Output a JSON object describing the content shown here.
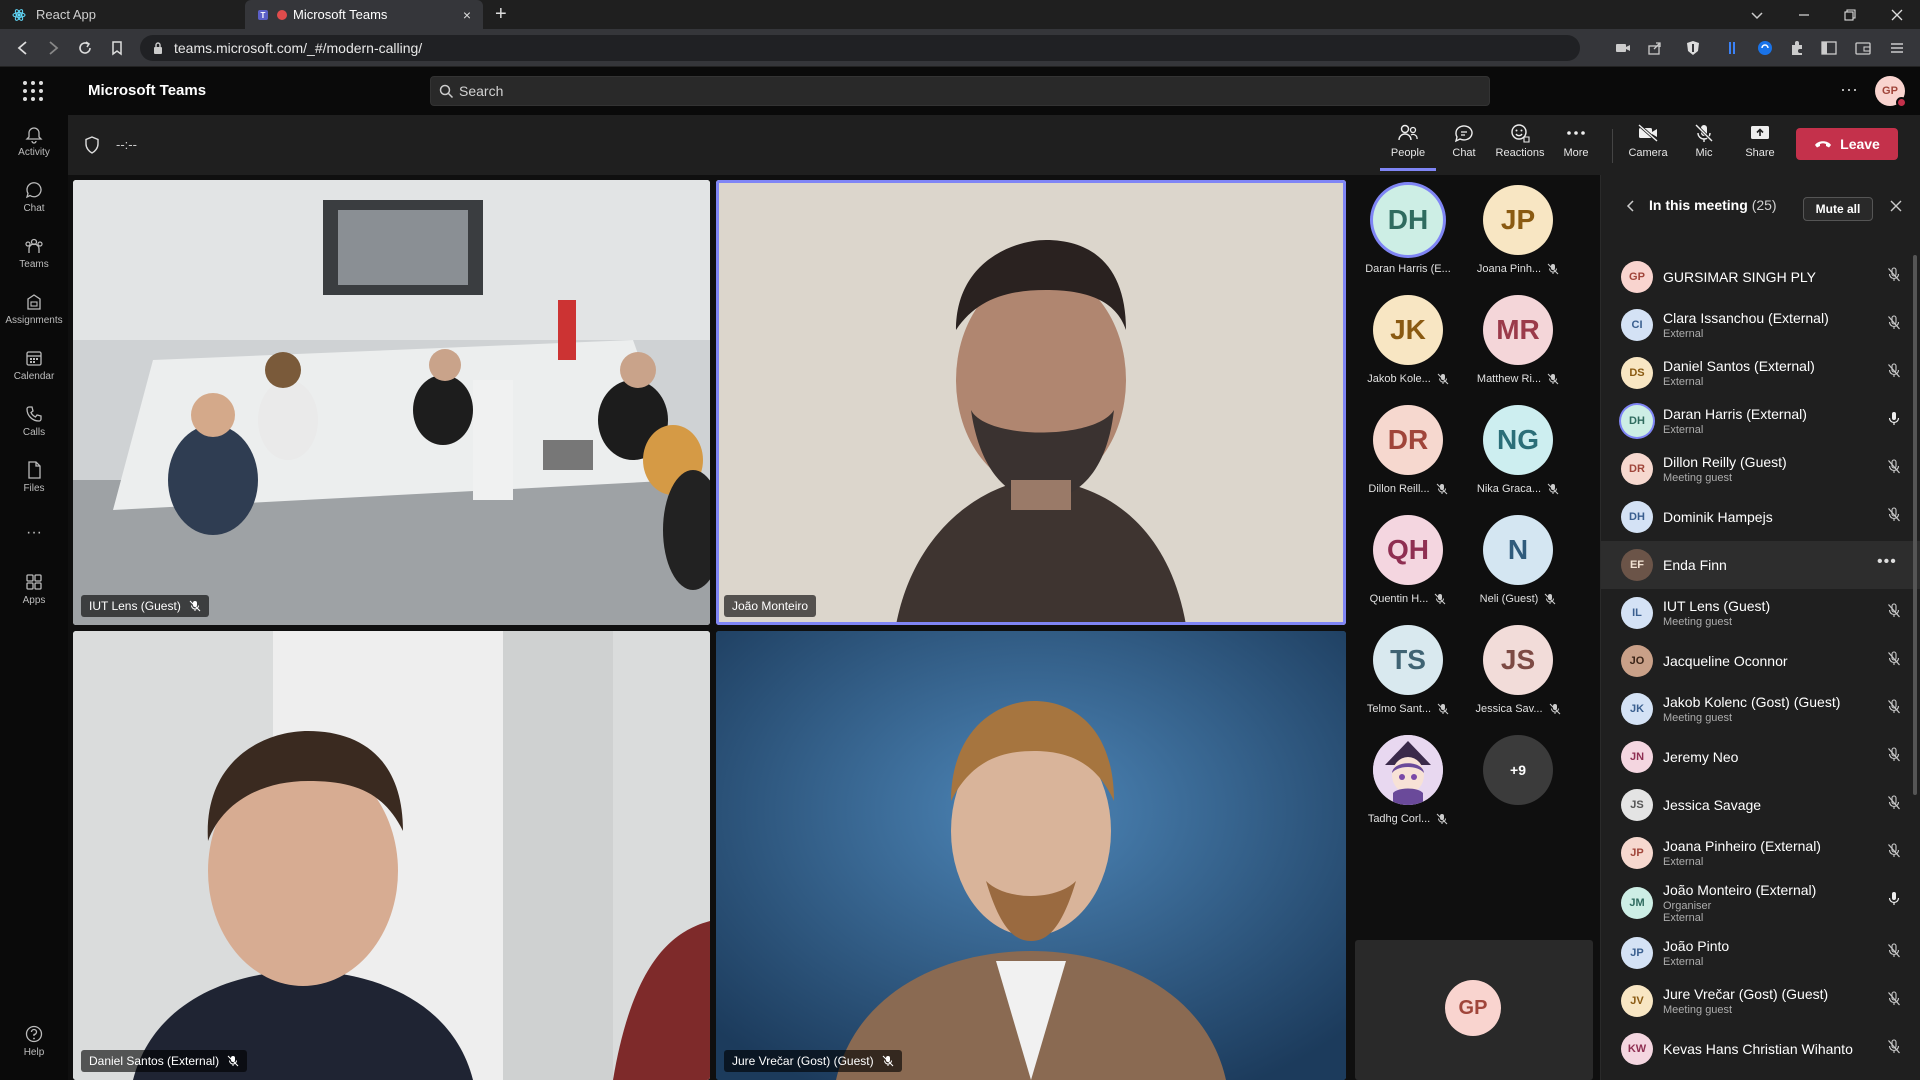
{
  "browser": {
    "tabs": [
      {
        "label": "React App"
      },
      {
        "label": "Microsoft Teams",
        "close": "×"
      }
    ],
    "new_tab": "+",
    "url": "teams.microsoft.com/_#/modern-calling/"
  },
  "teams": {
    "title": "Microsoft Teams",
    "search_placeholder": "Search",
    "more": "···",
    "user_initials": "GP"
  },
  "rail": [
    {
      "label": "Activity",
      "icon": "bell-icon"
    },
    {
      "label": "Chat",
      "icon": "chat-icon"
    },
    {
      "label": "Teams",
      "icon": "teams-icon"
    },
    {
      "label": "Assignments",
      "icon": "assignments-icon"
    },
    {
      "label": "Calendar",
      "icon": "calendar-icon"
    },
    {
      "label": "Calls",
      "icon": "phone-icon"
    },
    {
      "label": "Files",
      "icon": "file-icon"
    },
    {
      "label": "···",
      "icon": "more-icon"
    },
    {
      "label": "Apps",
      "icon": "apps-icon"
    },
    {
      "label": "Help",
      "icon": "help-icon"
    }
  ],
  "meeting": {
    "timer": "--:--",
    "toolbar": {
      "people": "People",
      "chat": "Chat",
      "reactions": "Reactions",
      "more": "More",
      "camera": "Camera",
      "mic": "Mic",
      "share": "Share",
      "leave": "Leave"
    },
    "tiles": [
      {
        "name": "IUT Lens (Guest)"
      },
      {
        "name": "João Monteiro"
      },
      {
        "name": "Daniel Santos (External)"
      },
      {
        "name": "Jure Vrečar (Gost) (Guest)"
      }
    ],
    "gallery": [
      {
        "initials": "DH",
        "label": "Daran Harris (E...",
        "bg": "#cdeee5",
        "fg": "#2f6b5f",
        "speaking": true
      },
      {
        "initials": "JP",
        "label": "Joana Pinh...",
        "bg": "#f8e6c3",
        "fg": "#8a5a12"
      },
      {
        "initials": "JK",
        "label": "Jakob Kole...",
        "bg": "#f8e6c3",
        "fg": "#8a5a12"
      },
      {
        "initials": "MR",
        "label": "Matthew Ri...",
        "bg": "#f4d6d9",
        "fg": "#9b3a4a"
      },
      {
        "initials": "DR",
        "label": "Dillon Reill...",
        "bg": "#f6d8cf",
        "fg": "#a0453a"
      },
      {
        "initials": "NG",
        "label": "Nika Graca...",
        "bg": "#cdeef0",
        "fg": "#2b6e78"
      },
      {
        "initials": "QH",
        "label": "Quentin H...",
        "bg": "#f4d6e0",
        "fg": "#8f2f52"
      },
      {
        "initials": "N",
        "label": "Neli (Guest)",
        "bg": "#d4e6f2",
        "fg": "#2f5b7c"
      },
      {
        "initials": "TS",
        "label": "Telmo Sant...",
        "bg": "#d9e9ef",
        "fg": "#3f6373"
      },
      {
        "initials": "JS",
        "label": "Jessica Sav...",
        "bg": "#f2dcd9",
        "fg": "#7d4a44"
      },
      {
        "initials": "",
        "label": "Tadhg Corl...",
        "bg": "#e8d8f0",
        "fg": "#5c3c78"
      },
      {
        "initials": "+9",
        "label": "",
        "bg": "#3b3b3b",
        "fg": "#ffffff"
      }
    ],
    "self_initials": "GP"
  },
  "panel": {
    "title": "In this meeting",
    "count": "(25)",
    "mute_all": "Mute all",
    "participants": [
      {
        "initials": "GP",
        "name": "GURSIMAR SINGH PLY",
        "sub": "",
        "bg": "#f9d4cf",
        "fg": "#a0453a",
        "mic": "muted"
      },
      {
        "initials": "CI",
        "name": "Clara Issanchou (External)",
        "sub": "External",
        "bg": "#d4e2f5",
        "fg": "#3a5f8f",
        "mic": "muted"
      },
      {
        "initials": "DS",
        "name": "Daniel Santos (External)",
        "sub": "External",
        "bg": "#f8e6c3",
        "fg": "#8a5a12",
        "mic": "muted"
      },
      {
        "initials": "DH",
        "name": "Daran Harris (External)",
        "sub": "External",
        "bg": "#cdeee5",
        "fg": "#2f6b5f",
        "mic": "on"
      },
      {
        "initials": "DR",
        "name": "Dillon Reilly (Guest)",
        "sub": "Meeting guest",
        "bg": "#f6d8cf",
        "fg": "#a0453a",
        "mic": "muted"
      },
      {
        "initials": "DH",
        "name": "Dominik Hampejs",
        "sub": "",
        "bg": "#d4e2f5",
        "fg": "#3a5f8f",
        "mic": "muted"
      },
      {
        "initials": "EF",
        "name": "Enda Finn",
        "sub": "",
        "bg": "#6b5448",
        "fg": "#f2e2d2",
        "mic": "more"
      },
      {
        "initials": "IL",
        "name": "IUT Lens (Guest)",
        "sub": "Meeting guest",
        "bg": "#d4e2f5",
        "fg": "#3a5f8f",
        "mic": "muted"
      },
      {
        "initials": "JO",
        "name": "Jacqueline Oconnor",
        "sub": "",
        "bg": "#c9a088",
        "fg": "#3a2418",
        "mic": "muted"
      },
      {
        "initials": "JK",
        "name": "Jakob Kolenc (Gost) (Guest)",
        "sub": "Meeting guest",
        "bg": "#d4e2f5",
        "fg": "#3a5f8f",
        "mic": "muted"
      },
      {
        "initials": "JN",
        "name": "Jeremy Neo",
        "sub": "",
        "bg": "#f4d6e0",
        "fg": "#8f2f52",
        "mic": "muted"
      },
      {
        "initials": "JS",
        "name": "Jessica Savage",
        "sub": "",
        "bg": "#e4e4e4",
        "fg": "#555555",
        "mic": "muted"
      },
      {
        "initials": "JP",
        "name": "Joana Pinheiro (External)",
        "sub": "External",
        "bg": "#f6d8cf",
        "fg": "#a0453a",
        "mic": "muted"
      },
      {
        "initials": "JM",
        "name": "João Monteiro (External)",
        "sub": "Organiser",
        "sub2": "External",
        "bg": "#cdeee5",
        "fg": "#2f6b5f",
        "mic": "on"
      },
      {
        "initials": "JP",
        "name": "João Pinto",
        "sub": "External",
        "bg": "#d4e2f5",
        "fg": "#3a5f8f",
        "mic": "muted"
      },
      {
        "initials": "JV",
        "name": "Jure Vrečar (Gost) (Guest)",
        "sub": "Meeting guest",
        "bg": "#f8e6c3",
        "fg": "#8a5a12",
        "mic": "muted"
      },
      {
        "initials": "KW",
        "name": "Kevas Hans Christian Wihanto",
        "sub": "",
        "bg": "#f4d6e0",
        "fg": "#8f2f52",
        "mic": "muted"
      }
    ]
  }
}
